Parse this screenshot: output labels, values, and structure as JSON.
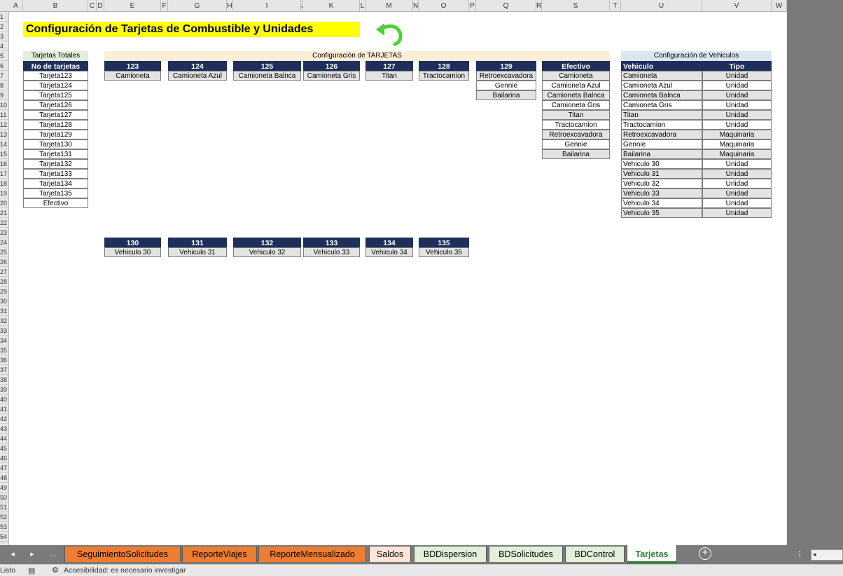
{
  "columns": [
    "A",
    "B",
    "C",
    "D",
    "E",
    "F",
    "G",
    "H",
    "I",
    "J",
    "K",
    "L",
    "M",
    "N",
    "O",
    "P",
    "Q",
    "R",
    "S",
    "T",
    "U",
    "V",
    "W"
  ],
  "rows": [
    "1",
    "2",
    "3",
    "4",
    "5",
    "6",
    "7",
    "8",
    "9",
    "10",
    "11",
    "12",
    "13",
    "14",
    "15",
    "16",
    "17",
    "18",
    "19",
    "20",
    "21",
    "22",
    "23",
    "24",
    "25",
    "26",
    "27",
    "28",
    "29",
    "30",
    "31",
    "32",
    "33",
    "34",
    "35",
    "36",
    "37",
    "38",
    "39",
    "40",
    "41",
    "42",
    "43",
    "44",
    "45",
    "46",
    "47",
    "48",
    "49",
    "50",
    "51",
    "52",
    "53",
    "54"
  ],
  "title": "Configuración de Tarjetas de Combustible y Unidades",
  "back_icon": "green-curved-back-arrow",
  "totales": {
    "caption": "Tarjetas Totales",
    "header": "No de tarjetas",
    "items": [
      "Tarjeta123",
      "Tarjeta124",
      "Tarjeta125",
      "Tarjeta126",
      "Tarjeta127",
      "Tarjeta128",
      "Tarjeta129",
      "Tarjeta130",
      "Tarjeta131",
      "Tarjeta132",
      "Tarjeta133",
      "Tarjeta134",
      "Tarjeta135",
      "Efectivo"
    ]
  },
  "config_tarjetas": {
    "caption": "Configuración de TARJETAS",
    "top": [
      {
        "header": "123",
        "items": [
          "Camioneta"
        ]
      },
      {
        "header": "124",
        "items": [
          "Camioneta Azul"
        ]
      },
      {
        "header": "125",
        "items": [
          "Camioneta Balnca"
        ]
      },
      {
        "header": "126",
        "items": [
          "Camioneta Gris"
        ]
      },
      {
        "header": "127",
        "items": [
          "Titan"
        ]
      },
      {
        "header": "128",
        "items": [
          "Tractocamion"
        ]
      },
      {
        "header": "129",
        "items": [
          "Retroexcavadora",
          "Gennie",
          "Bailarina"
        ]
      },
      {
        "header": "Efectivo",
        "items": [
          "Camioneta",
          "Camioneta Azul",
          "Camioneta Balnca",
          "Camioneta Gris",
          "Titan",
          "Tractocamion",
          "Retroexcavadora",
          "Gennie",
          "Bailarina"
        ]
      }
    ],
    "bottom": [
      {
        "header": "130",
        "items": [
          "Vehiculo 30"
        ]
      },
      {
        "header": "131",
        "items": [
          "Vehiculo 31"
        ]
      },
      {
        "header": "132",
        "items": [
          "Vehiculo 32"
        ]
      },
      {
        "header": "133",
        "items": [
          "Vehiculo 33"
        ]
      },
      {
        "header": "134",
        "items": [
          "Vehiculo 34"
        ]
      },
      {
        "header": "135",
        "items": [
          "Vehiculo 35"
        ]
      }
    ]
  },
  "vehiculos": {
    "caption": "Configuración de Vehiculos",
    "headers": [
      "Vehiculo",
      "Tipo"
    ],
    "rows": [
      [
        "Camioneta",
        "Unidad"
      ],
      [
        "Camioneta Azul",
        "Unidad"
      ],
      [
        "Camioneta Balnca",
        "Unidad"
      ],
      [
        "Camioneta Gris",
        "Unidad"
      ],
      [
        "Titan",
        "Unidad"
      ],
      [
        "Tractocamion",
        "Unidad"
      ],
      [
        "Retroexcavadora",
        "Maquinaria"
      ],
      [
        "Gennie",
        "Maquinaria"
      ],
      [
        "Bailarina",
        "Maquinaria"
      ],
      [
        "Vehiculo 30",
        "Unidad"
      ],
      [
        "Vehiculo 31",
        "Unidad"
      ],
      [
        "Vehiculo 32",
        "Unidad"
      ],
      [
        "Vehiculo 33",
        "Unidad"
      ],
      [
        "Vehiculo 34",
        "Unidad"
      ],
      [
        "Vehiculo 35",
        "Unidad"
      ]
    ]
  },
  "tabs": {
    "prev": "◂",
    "next": "▸",
    "more": "...",
    "items": [
      "SeguimientoSolicitudes",
      "ReporteViajes",
      "ReporteMensualizado",
      "Saldos",
      "BDDispersion",
      "BDSolicitudes",
      "BDControl",
      "Tarjetas"
    ],
    "add": "+",
    "menu": "⋮"
  },
  "status": {
    "ready": "Listo",
    "accessibility": "Accesibilidad: es necesario investigar"
  },
  "colors": {
    "header_navy": "#1f2f5c",
    "title_yellow": "#ffff00",
    "tab_orange": "#ed7d31",
    "tab_green": "#e2efda",
    "active_tab_text": "#2e7d32",
    "back_arrow": "#4cd137"
  }
}
